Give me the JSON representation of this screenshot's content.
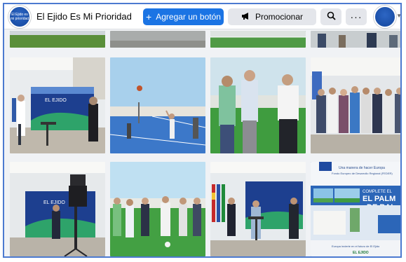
{
  "topbar": {
    "page_name": "El Ejido Es Mi Prioridad",
    "page_avatar_text": "El Ejido es mi prioridad",
    "add_button_label": "Agregar un botón",
    "add_button_icon": "plus-icon",
    "promote_label": "Promocionar",
    "promote_icon": "megaphone-icon",
    "search_icon": "search-icon",
    "more_icon": "more-icon"
  },
  "photos": [
    {
      "name": "photo-row0-1",
      "scene": "green-field"
    },
    {
      "name": "photo-row0-2",
      "scene": "gray-wall"
    },
    {
      "name": "photo-row0-3",
      "scene": "field-net"
    },
    {
      "name": "photo-row0-4",
      "scene": "people-crowd"
    },
    {
      "name": "photo-presentation-screen",
      "scene": "screen-speaker",
      "screen_title": "EL EJIDO"
    },
    {
      "name": "photo-basketball-court",
      "scene": "court"
    },
    {
      "name": "photo-three-men-field",
      "scene": "three-men"
    },
    {
      "name": "photo-group-standing",
      "scene": "group"
    },
    {
      "name": "photo-camera-screen",
      "scene": "camera",
      "screen_title": "EL EJIDO"
    },
    {
      "name": "photo-group-field",
      "scene": "group-field"
    },
    {
      "name": "photo-speaker-podium",
      "scene": "podium"
    },
    {
      "name": "photo-poster",
      "scene": "poster",
      "poster_top": "Una manera de hacer Europa",
      "poster_sub": "Fondo Europeo de Desarrollo Regional (FEDER)",
      "poster_heading1": "COMPLETE EL",
      "poster_heading2": "EL PALM",
      "poster_heading3": "DE BAL",
      "poster_footer": "Europa invierte en el futuro de El Ejido",
      "poster_brand": "EL EJIDO"
    }
  ]
}
